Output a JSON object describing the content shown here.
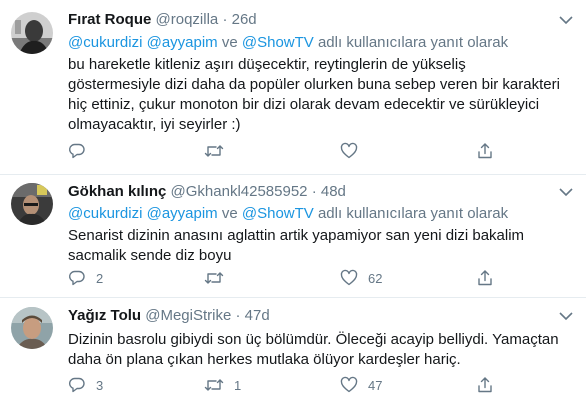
{
  "colors": {
    "text": "#14171a",
    "secondary": "#657786",
    "link": "#1b95e0",
    "divider": "#e6ecf0"
  },
  "reply_prefix_word": "ve",
  "reply_suffix": "adlı kullanıcılara yanıt olarak",
  "tweets": [
    {
      "name": "Fırat Roque",
      "handle": "@roqzilla",
      "dot": "·",
      "time": "26d",
      "mentions": [
        "@cukurdizi",
        "@ayyapim",
        "@ShowTV"
      ],
      "lines": [
        "bu hareketle kitleniz aşırı düşecektir, reytinglerin de yükseliş",
        "göstermesiyle dizi daha da popüler olurken buna sebep veren bir karakteri",
        "hiç ettiniz, çukur monoton bir dizi olarak devam edecektir ve sürükleyici",
        "olmayacaktır, iyi seyirler :)"
      ],
      "reply_count": "",
      "retweet_count": "",
      "like_count": "",
      "icons": [
        "reply-icon",
        "retweet-icon",
        "like-icon",
        "share-icon"
      ]
    },
    {
      "name": "Gökhan kılınç",
      "handle": "@Gkhankl42585952",
      "dot": "·",
      "time": "48d",
      "mentions": [
        "@cukurdizi",
        "@ayyapim",
        "@ShowTV"
      ],
      "lines": [
        "Senarist dizinin  anasını  aglattin artik yapamiyor san yeni dizi bakalim",
        "sacmalik sende diz boyu"
      ],
      "reply_count": "2",
      "retweet_count": "",
      "like_count": "62",
      "icons": [
        "reply-icon",
        "retweet-icon",
        "like-icon",
        "share-icon"
      ]
    },
    {
      "name": "Yağız Tolu",
      "handle": "@MegiStrike",
      "dot": "·",
      "time": "47d",
      "lines": [
        "Dizinin basrolu gibiydi son üç bölümdür. Öleceği acayip belliydi. Yamaçtan",
        "daha ön plana çıkan herkes mutlaka ölüyor kardeşler hariç."
      ],
      "reply_count": "3",
      "retweet_count": "1",
      "like_count": "47",
      "icons": [
        "reply-icon",
        "retweet-icon",
        "like-icon",
        "share-icon"
      ]
    }
  ]
}
